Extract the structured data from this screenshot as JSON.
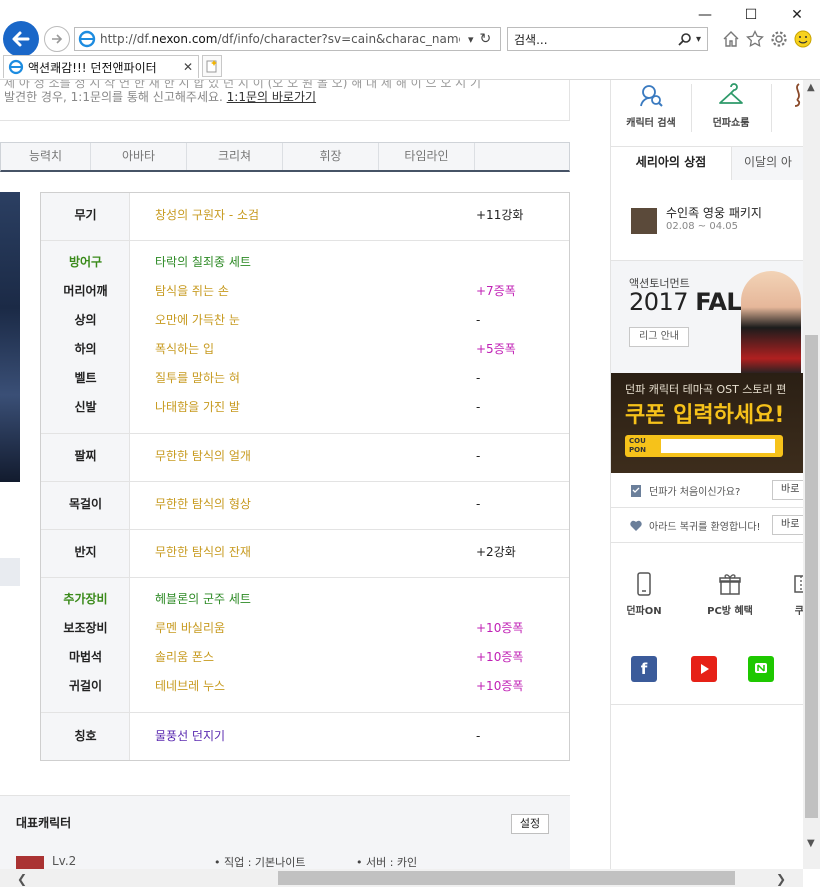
{
  "browser": {
    "url_prefix": "http://df.",
    "url_domain": "nexon.com",
    "url_rest": "/df/info/character?sv=cain&charac_name=%EC",
    "search_placeholder": "검색...",
    "tab_title": "액션쾌감!!! 던전앤파이터"
  },
  "notice": {
    "line1": "제 아 정 소를 정 시 작 연 한 재 한 시 합 있 던 지 이 (오 오 원 볼 오) 해 대 제 해 이 으 오 시 기",
    "line2_prefix": "발견한 경우, 1:1문의를 통해 신고해주세요.",
    "line2_link": "1:1문의 바로가기"
  },
  "tabs": [
    "능력치",
    "아바타",
    "크리쳐",
    "휘장",
    "타임라인"
  ],
  "equipment": {
    "weapon": {
      "slot": "무기",
      "name": "창성의 구원자 - 소검",
      "enh": "+11강화"
    },
    "armor_set_label": "방어구",
    "armor_set_name": "타락의 칠죄종 세트",
    "shoulder": {
      "slot": "머리어깨",
      "name": "탐식을 쥐는 손",
      "enh": "+7증폭"
    },
    "top": {
      "slot": "상의",
      "name": "오만에 가득찬 눈",
      "enh": "-"
    },
    "bottom": {
      "slot": "하의",
      "name": "폭식하는 입",
      "enh": "+5증폭"
    },
    "belt": {
      "slot": "벨트",
      "name": "질투를 말하는 혀",
      "enh": "-"
    },
    "shoes": {
      "slot": "신발",
      "name": "나태함을 가진 발",
      "enh": "-"
    },
    "bracelet": {
      "slot": "팔찌",
      "name": "무한한 탐식의 얼개",
      "enh": "-"
    },
    "necklace": {
      "slot": "목걸이",
      "name": "무한한 탐식의 형상",
      "enh": "-"
    },
    "ring": {
      "slot": "반지",
      "name": "무한한 탐식의 잔재",
      "enh": "+2강화"
    },
    "extra_set_label": "추가장비",
    "extra_set_name": "헤블론의 군주 세트",
    "sub": {
      "slot": "보조장비",
      "name": "루멘 바실리움",
      "enh": "+10증폭"
    },
    "magic": {
      "slot": "마법석",
      "name": "솔리움 폰스",
      "enh": "+10증폭"
    },
    "earring": {
      "slot": "귀걸이",
      "name": "테네브레 누스",
      "enh": "+10증폭"
    },
    "title": {
      "slot": "칭호",
      "name": "물풍선 던지기",
      "enh": "-"
    }
  },
  "rep": {
    "title": "대표캐릭터",
    "btn": "설정",
    "level": "Lv.2",
    "job": "• 직업 : 기본나이트",
    "server": "• 서버 : 카인"
  },
  "sidebar": {
    "quick1": "캐릭터 검색",
    "quick2": "던파쇼룸",
    "shop_tab_active": "세리아의 상점",
    "shop_tab_other": "이달의 아",
    "pkg_name": "수인족 영웅 패키지",
    "pkg_date": "02.08 ~ 04.05",
    "league_sub": "액션토너먼트",
    "league_year": "2017",
    "league_season": "FALL",
    "league_btn": "리그 안내",
    "coupon_sub": "던파 캐릭터 테마곡 OST 스토리 편",
    "coupon_main": "쿠폰 입력하세요!",
    "coupon_label": "COU\nPON",
    "first_time": "던파가 처음이신가요?",
    "first_btn": "바로",
    "welcome": "아라드 복귀를 환영합니다!",
    "welcome_btn": "바로",
    "q_on": "던파ON",
    "q_pc": "PC방 혜택",
    "q_coupon": "쿠폰"
  },
  "colors": {
    "item_gold": "#c79a1f",
    "set_green": "#2d8a25",
    "amp_magenta": "#c021b5",
    "title_purple": "#5b2bb0",
    "ie_blue": "#1a67c8"
  }
}
